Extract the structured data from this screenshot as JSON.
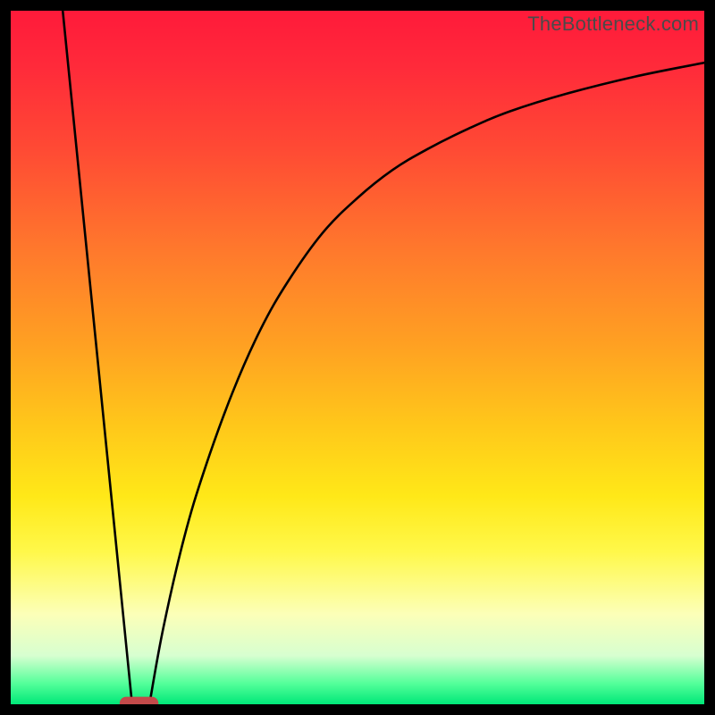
{
  "watermark": "TheBottleneck.com",
  "colors": {
    "frame": "#000000",
    "curve": "#000000",
    "marker_fill": "#c34a4a",
    "gradient_top": "#ff1a3a",
    "gradient_bottom": "#00e878"
  },
  "chart_data": {
    "type": "line",
    "title": "",
    "xlabel": "",
    "ylabel": "",
    "xlim": [
      0,
      100
    ],
    "ylim": [
      0,
      100
    ],
    "grid": false,
    "legend": false,
    "annotations": [
      "TheBottleneck.com"
    ],
    "series": [
      {
        "name": "left-falling-line",
        "x": [
          7.5,
          17.5
        ],
        "values": [
          100,
          0
        ]
      },
      {
        "name": "right-rising-curve",
        "x": [
          20.0,
          22,
          25,
          28,
          32,
          36,
          40,
          45,
          50,
          55,
          60,
          66,
          72,
          80,
          90,
          100
        ],
        "values": [
          0,
          11,
          24,
          34,
          45,
          54,
          61,
          68,
          73,
          77,
          80,
          83,
          85.5,
          88,
          90.5,
          92.5
        ]
      }
    ],
    "marker": {
      "name": "vertex-pill",
      "shape": "rounded-rect",
      "x_center": 18.5,
      "y": 0,
      "width_x_units": 5.6,
      "height_y_units": 1.9,
      "fill": "#c34a4a"
    },
    "background": {
      "type": "vertical-gradient",
      "description": "red (top) → orange → yellow → pale-yellow → pale-green → green (bottom)"
    }
  }
}
